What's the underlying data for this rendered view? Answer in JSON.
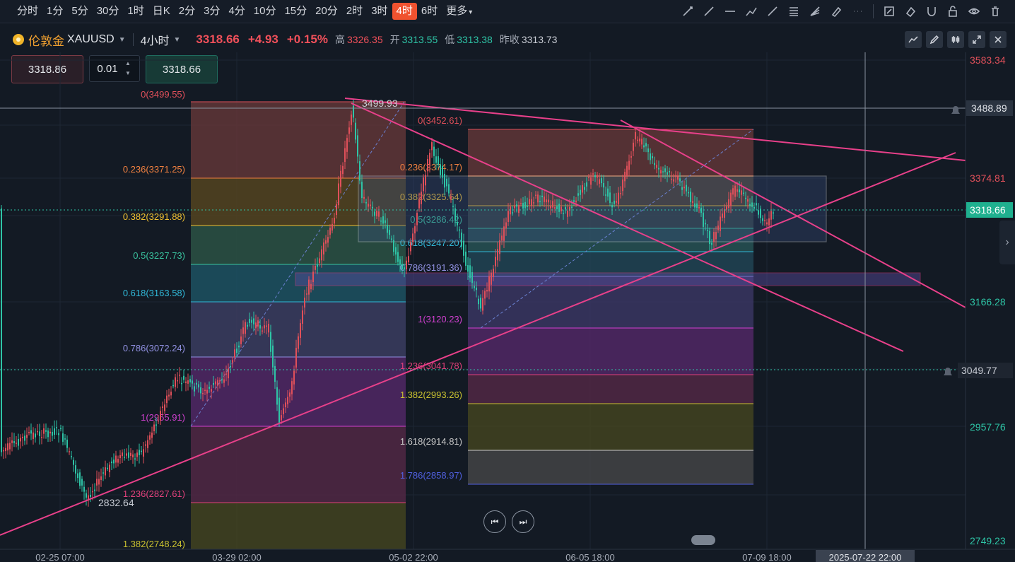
{
  "timeframes": [
    "分时",
    "1分",
    "5分",
    "30分",
    "1时",
    "日K",
    "2分",
    "3分",
    "4分",
    "10分",
    "15分",
    "20分",
    "2时",
    "3时",
    "4时",
    "6时",
    "更多"
  ],
  "active_timeframe": "4时",
  "drawing_tools": [
    "trend-line-icon",
    "ray-icon",
    "horizontal-line-icon",
    "polyline-icon",
    "brush-icon",
    "fib-retracement-icon",
    "fib-fan-icon",
    "highlighter-icon",
    "more-dots-icon",
    "edit-icon",
    "eraser-icon",
    "magnet-icon",
    "lock-icon",
    "eye-icon",
    "trash-icon"
  ],
  "symbol": {
    "name": "伦敦金",
    "code": "XAUUSD",
    "interval": "4小时",
    "price": "3318.66",
    "change": "+4.93",
    "change_pct": "+0.15%",
    "high_label": "高",
    "high": "3326.35",
    "open_label": "开",
    "open": "3313.55",
    "low_label": "低",
    "low": "3313.38",
    "prev_label": "昨收",
    "prev": "3313.73"
  },
  "trade": {
    "sell": "3318.86",
    "lot": "0.01",
    "buy": "3318.66"
  },
  "price_axis": {
    "labels": [
      {
        "value": "3583.34",
        "color": "#e0505a"
      },
      {
        "value": "3374.81",
        "color": "#e0505a"
      },
      {
        "value": "3166.28",
        "color": "#2ec4a6"
      },
      {
        "value": "2957.76",
        "color": "#2ec4a6"
      },
      {
        "value": "2749.23",
        "color": "#2ec4a6"
      }
    ],
    "alert_lines": [
      "3488.89",
      "3049.77"
    ],
    "current": "3318.66"
  },
  "time_axis": [
    "02-25 07:00",
    "03-29 02:00",
    "05-02 22:00",
    "06-05 18:00",
    "07-09 18:00"
  ],
  "crosshair_time": "2025-07-22 22:00",
  "fib_left": [
    {
      "label": "0(3499.55)",
      "color": "#e0505a"
    },
    {
      "label": "0.236(3371.25)",
      "color": "#f08040"
    },
    {
      "label": "0.382(3291.88)",
      "color": "#f0c030"
    },
    {
      "label": "0.5(3227.73)",
      "color": "#3ac4a0"
    },
    {
      "label": "0.618(3163.58)",
      "color": "#30b8d8"
    },
    {
      "label": "0.786(3072.24)",
      "color": "#9090e0"
    },
    {
      "label": "1(2955.91)",
      "color": "#d040d0"
    },
    {
      "label": "1.236(2827.61)",
      "color": "#e0407a"
    },
    {
      "label": "1.382(2748.24)",
      "color": "#c8c030"
    }
  ],
  "fib_right": [
    {
      "label": "0(3452.61)",
      "color": "#e0505a"
    },
    {
      "label": "0.236(3374.17)",
      "color": "#f08040"
    },
    {
      "label": "0.382(3325.64)",
      "color": "#f0c030"
    },
    {
      "label": "0.5(3286.42)",
      "color": "#3ac4a0"
    },
    {
      "label": "0.618(3247.20)",
      "color": "#30b8d8"
    },
    {
      "label": "0.786(3191.36)",
      "color": "#9090e0"
    },
    {
      "label": "1(3120.23)",
      "color": "#d040d0"
    },
    {
      "label": "1.236(3041.78)",
      "color": "#e0407a"
    },
    {
      "label": "1.382(2993.26)",
      "color": "#c8c030"
    },
    {
      "label": "1.618(2914.81)",
      "color": "#c8c8c8"
    },
    {
      "label": "1.786(2858.97)",
      "color": "#5060e0"
    }
  ],
  "annotations": {
    "high_mark": "3499.93",
    "low_mark": "2832.64"
  },
  "colors": {
    "up": "#e0505a",
    "down": "#2ec4a6",
    "trend": "#e8408a",
    "active": "#f0522f"
  }
}
